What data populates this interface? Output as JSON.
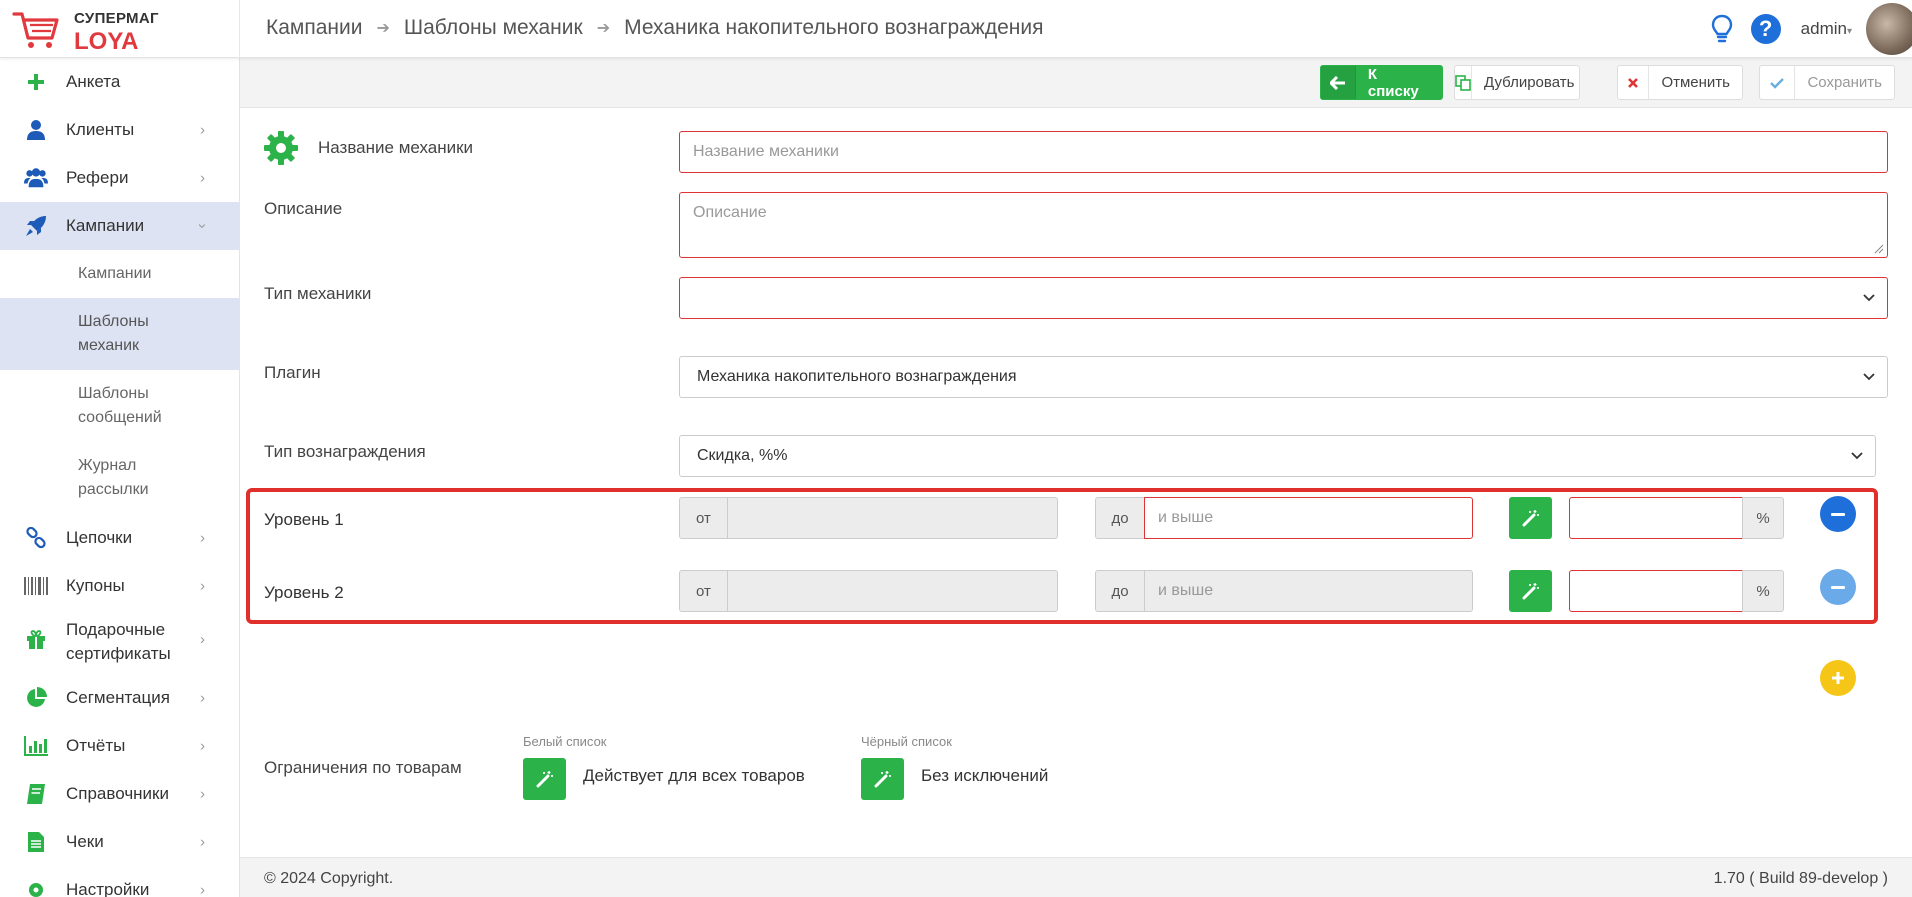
{
  "app": {
    "logo_line1": "СУПЕРМАГ",
    "logo_line2": "LOYA",
    "user": "admin",
    "accent": "#2bb34a",
    "error": "#e03434"
  },
  "breadcrumb": [
    "Кампании",
    "Шаблоны механик",
    "Механика накопительного вознаграждения"
  ],
  "sidebar": {
    "items": [
      {
        "label": "Анкета",
        "icon": "plus-icon"
      },
      {
        "label": "Клиенты",
        "icon": "user-icon"
      },
      {
        "label": "Рефери",
        "icon": "users-icon"
      },
      {
        "label": "Кампании",
        "icon": "rocket-icon"
      },
      {
        "label": "Цепочки",
        "icon": "link-icon"
      },
      {
        "label": "Купоны",
        "icon": "barcode-icon"
      },
      {
        "label": "Подарочные сертификаты",
        "icon": "gift-icon"
      },
      {
        "label": "Сегментация",
        "icon": "pie-icon"
      },
      {
        "label": "Отчёты",
        "icon": "chart-icon"
      },
      {
        "label": "Справочники",
        "icon": "book-icon"
      },
      {
        "label": "Чеки",
        "icon": "doc-icon"
      },
      {
        "label": "Настройки",
        "icon": "gear-icon"
      }
    ],
    "sub_items": [
      "Кампании",
      "Шаблоны механик",
      "Шаблоны сообщений",
      "Журнал рассылки"
    ]
  },
  "toolbar": {
    "back": "К списку",
    "duplicate": "Дублировать",
    "cancel": "Отменить",
    "save": "Сохранить"
  },
  "form": {
    "name_label": "Название механики",
    "name_placeholder": "Название механики",
    "desc_label": "Описание",
    "desc_placeholder": "Описание",
    "type_label": "Тип механики",
    "type_value": "",
    "plugin_label": "Плагин",
    "plugin_value": "Механика накопительного вознаграждения",
    "reward_label": "Тип вознаграждения",
    "reward_value": "Скидка, %%"
  },
  "levels": [
    {
      "label": "Уровень 1",
      "from": "от",
      "to": "до",
      "to_placeholder": "и выше",
      "unit": "%"
    },
    {
      "label": "Уровень 2",
      "from": "от",
      "to": "до",
      "to_placeholder": "и выше",
      "unit": "%"
    }
  ],
  "restrictions": {
    "label": "Ограничения по товарам",
    "white_caption": "Белый список",
    "white_text": "Действует для всех товаров",
    "black_caption": "Чёрный список",
    "black_text": "Без исключений"
  },
  "footer": {
    "copyright": "© 2024 Copyright.",
    "version": "1.70 ( Build 89-develop )"
  }
}
